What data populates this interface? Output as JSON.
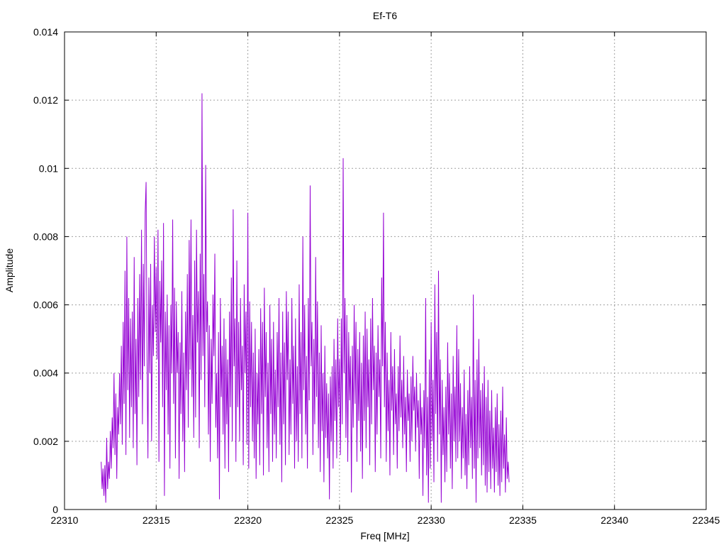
{
  "chart_data": {
    "type": "line",
    "title": "Ef-T6",
    "xlabel": "Freq [MHz]",
    "ylabel": "Amplitude",
    "xlim": [
      22310,
      22345
    ],
    "ylim": [
      0,
      0.014
    ],
    "xticks": [
      "22310",
      "22315",
      "22320",
      "22325",
      "22330",
      "22335",
      "22340",
      "22345"
    ],
    "yticks": [
      "0",
      "0.002",
      "0.004",
      "0.006",
      "0.008",
      "0.01",
      "0.012",
      "0.014"
    ],
    "grid": true,
    "legend": "none",
    "series": [
      {
        "color": "#9400D3",
        "x_start": 22312.0,
        "x_step": 0.05,
        "y": [
          0.0014,
          0.0006,
          0.0012,
          0.0004,
          0.0013,
          0.0002,
          0.0021,
          0.0006,
          0.0014,
          0.0009,
          0.0023,
          0.0012,
          0.0027,
          0.0018,
          0.004,
          0.0016,
          0.0034,
          0.0009,
          0.003,
          0.0022,
          0.004,
          0.0025,
          0.0048,
          0.0019,
          0.0055,
          0.0031,
          0.007,
          0.0016,
          0.008,
          0.0035,
          0.0062,
          0.0021,
          0.0056,
          0.003,
          0.0058,
          0.0018,
          0.0074,
          0.0028,
          0.005,
          0.0013,
          0.0062,
          0.0033,
          0.0069,
          0.0038,
          0.0082,
          0.0025,
          0.0072,
          0.0042,
          0.0087,
          0.0096,
          0.0045,
          0.0015,
          0.0068,
          0.004,
          0.0072,
          0.002,
          0.006,
          0.0045,
          0.008,
          0.0052,
          0.0071,
          0.0044,
          0.0082,
          0.0014,
          0.0067,
          0.0049,
          0.0073,
          0.003,
          0.0084,
          0.0004,
          0.0058,
          0.0035,
          0.0063,
          0.0022,
          0.0054,
          0.0012,
          0.006,
          0.004,
          0.0085,
          0.0031,
          0.0065,
          0.0015,
          0.0061,
          0.004,
          0.0052,
          0.0009,
          0.0049,
          0.0028,
          0.0064,
          0.002,
          0.0046,
          0.0011,
          0.0058,
          0.0035,
          0.0069,
          0.0024,
          0.0079,
          0.0041,
          0.0085,
          0.0033,
          0.0057,
          0.0021,
          0.0073,
          0.0027,
          0.0082,
          0.0049,
          0.0064,
          0.0018,
          0.0075,
          0.0038,
          0.0122,
          0.0045,
          0.0069,
          0.003,
          0.0101,
          0.0052,
          0.0061,
          0.0022,
          0.0054,
          0.0014,
          0.005,
          0.0031,
          0.0063,
          0.0045,
          0.0075,
          0.0024,
          0.004,
          0.0015,
          0.0052,
          0.0003,
          0.0062,
          0.0033,
          0.0048,
          0.0022,
          0.0056,
          0.0012,
          0.005,
          0.0025,
          0.0044,
          0.0011,
          0.0058,
          0.003,
          0.0068,
          0.002,
          0.0088,
          0.0042,
          0.0056,
          0.0014,
          0.0073,
          0.003,
          0.0055,
          0.002,
          0.0062,
          0.0035,
          0.0048,
          0.0013,
          0.0066,
          0.004,
          0.0058,
          0.0019,
          0.0087,
          0.0012,
          0.0061,
          0.003,
          0.0055,
          0.002,
          0.0046,
          0.0015,
          0.0053,
          0.0009,
          0.004,
          0.0025,
          0.0047,
          0.0013,
          0.0059,
          0.0028,
          0.0055,
          0.001,
          0.0065,
          0.0033,
          0.0052,
          0.0018,
          0.0043,
          0.0011,
          0.006,
          0.0028,
          0.005,
          0.0014,
          0.0055,
          0.0022,
          0.0041,
          0.0015,
          0.0052,
          0.003,
          0.0062,
          0.0019,
          0.0046,
          0.0008,
          0.0058,
          0.0025,
          0.0049,
          0.0013,
          0.0064,
          0.0038,
          0.0058,
          0.0016,
          0.0044,
          0.0022,
          0.0062,
          0.0031,
          0.0048,
          0.0012,
          0.0056,
          0.002,
          0.0042,
          0.0014,
          0.0066,
          0.0028,
          0.0052,
          0.0015,
          0.008,
          0.0035,
          0.006,
          0.0022,
          0.0045,
          0.0012,
          0.0062,
          0.0032,
          0.0095,
          0.0042,
          0.0055,
          0.0016,
          0.005,
          0.0025,
          0.0074,
          0.0033,
          0.0061,
          0.0018,
          0.0046,
          0.0011,
          0.0054,
          0.0023,
          0.004,
          0.0008,
          0.0048,
          0.0021,
          0.0037,
          0.0015,
          0.0034,
          0.0003,
          0.0039,
          0.002,
          0.0042,
          0.0012,
          0.005,
          0.0026,
          0.0044,
          0.0015,
          0.0056,
          0.003,
          0.0044,
          0.0016,
          0.0056,
          0.0025,
          0.0103,
          0.004,
          0.0062,
          0.0021,
          0.0057,
          0.0014,
          0.0052,
          0.0032,
          0.0045,
          0.0005,
          0.0048,
          0.0024,
          0.006,
          0.0031,
          0.0055,
          0.0014,
          0.0047,
          0.0026,
          0.0052,
          0.0017,
          0.0043,
          0.0009,
          0.0051,
          0.0026,
          0.0058,
          0.0018,
          0.0053,
          0.003,
          0.0044,
          0.0013,
          0.0056,
          0.0025,
          0.0062,
          0.0035,
          0.0048,
          0.0011,
          0.0046,
          0.0022,
          0.0054,
          0.0033,
          0.0044,
          0.0015,
          0.0068,
          0.0042,
          0.0087,
          0.003,
          0.0055,
          0.0014,
          0.0046,
          0.0023,
          0.0038,
          0.001,
          0.0052,
          0.0029,
          0.0042,
          0.0016,
          0.0047,
          0.0025,
          0.0034,
          0.0012,
          0.0042,
          0.0023,
          0.0051,
          0.0027,
          0.0038,
          0.0018,
          0.0045,
          0.0022,
          0.0033,
          0.0011,
          0.0041,
          0.0026,
          0.0034,
          0.0014,
          0.0039,
          0.002,
          0.0045,
          0.0029,
          0.0036,
          0.0017,
          0.004,
          0.0024,
          0.0032,
          0.0009,
          0.0037,
          0.0022,
          0.003,
          0.0004,
          0.0035,
          0.0018,
          0.0062,
          0.001,
          0.0033,
          0.0002,
          0.0044,
          0.0012,
          0.0055,
          0.002,
          0.0038,
          0.0008,
          0.0066,
          0.0028,
          0.0052,
          0.0014,
          0.007,
          0.0022,
          0.0044,
          0.0002,
          0.0038,
          0.0016,
          0.003,
          0.0008,
          0.0036,
          0.0011,
          0.0049,
          0.0022,
          0.004,
          0.0012,
          0.0034,
          0.0006,
          0.0045,
          0.002,
          0.0036,
          0.0014,
          0.0054,
          0.0015,
          0.0047,
          0.002,
          0.0037,
          0.0009,
          0.003,
          0.0015,
          0.0041,
          0.001,
          0.0028,
          0.0006,
          0.0035,
          0.0013,
          0.0042,
          0.0018,
          0.0033,
          0.0009,
          0.0063,
          0.0012,
          0.0038,
          0.0002,
          0.0044,
          0.0015,
          0.005,
          0.0018,
          0.0035,
          0.001,
          0.0037,
          0.0013,
          0.0042,
          0.0007,
          0.0033,
          0.0005,
          0.0038,
          0.0011,
          0.0029,
          0.0006,
          0.0035,
          0.0012,
          0.0024,
          0.0005,
          0.003,
          0.0011,
          0.0034,
          0.0007,
          0.0025,
          0.0004,
          0.0029,
          0.0008,
          0.0036,
          0.0012,
          0.0022,
          0.0005,
          0.0027,
          0.0009,
          0.0014,
          0.0008
        ]
      }
    ]
  }
}
